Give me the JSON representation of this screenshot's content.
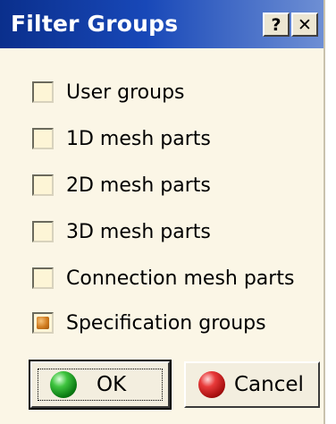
{
  "window": {
    "title": "Filter Groups",
    "help_label": "?",
    "close_label": "✕"
  },
  "options": [
    {
      "label": "User groups",
      "checked": false
    },
    {
      "label": "1D mesh parts",
      "checked": false
    },
    {
      "label": "2D mesh parts",
      "checked": false
    },
    {
      "label": "3D mesh parts",
      "checked": false
    },
    {
      "label": "Connection mesh parts",
      "checked": false
    },
    {
      "label": "Specification groups",
      "checked": true
    }
  ],
  "buttons": {
    "ok_label": "OK",
    "cancel_label": "Cancel"
  },
  "colors": {
    "titlebar": "#0a2f8c",
    "dialog_bg": "#fbf6e6",
    "checkbox_mark": "#d07b1e"
  },
  "icons": {
    "ok": "green-ball-icon",
    "cancel": "red-ball-icon"
  }
}
